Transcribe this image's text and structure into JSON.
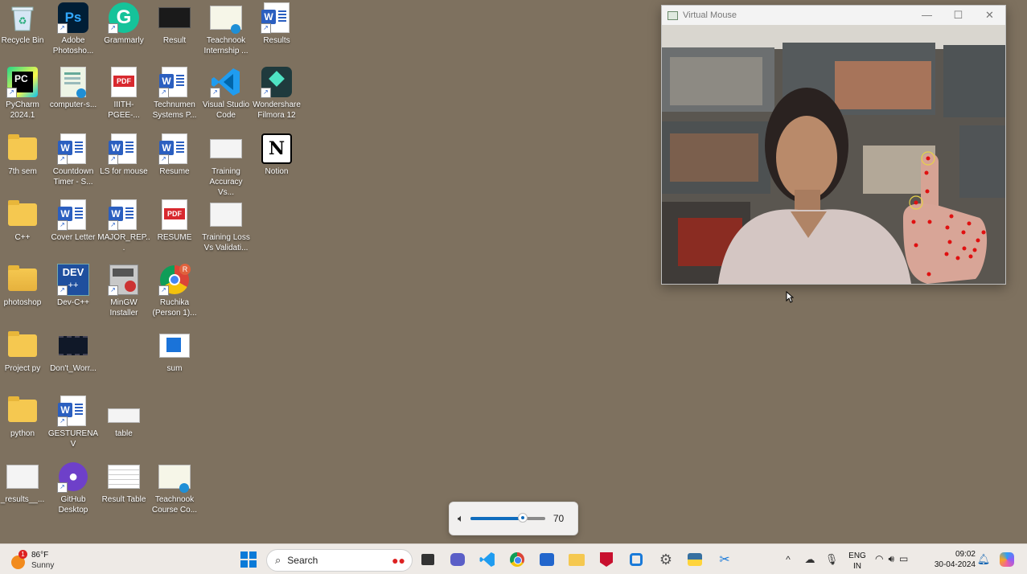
{
  "desktop": {
    "icons": [
      {
        "label": "Recycle Bin",
        "icon": "recycle-bin-icon"
      },
      {
        "label": "Adobe Photosho...",
        "icon": "photoshop-icon"
      },
      {
        "label": "Grammarly",
        "icon": "grammarly-icon"
      },
      {
        "label": "Result",
        "icon": "image-thumbnail-icon"
      },
      {
        "label": "Teachnook Internship ...",
        "icon": "certificate-edge-icon"
      },
      {
        "label": "Results",
        "icon": "word-doc-icon"
      },
      {
        "label": "PyCharm 2024.1",
        "icon": "pycharm-icon"
      },
      {
        "label": "computer-s...",
        "icon": "document-edge-icon"
      },
      {
        "label": "IIITH-PGEE-...",
        "icon": "pdf-icon"
      },
      {
        "label": "Technumen Systems P...",
        "icon": "word-doc-icon"
      },
      {
        "label": "Visual Studio Code",
        "icon": "vscode-icon"
      },
      {
        "label": "Wondershare Filmora 12",
        "icon": "filmora-icon"
      },
      {
        "label": "7th sem",
        "icon": "folder-icon"
      },
      {
        "label": "Countdown Timer - S...",
        "icon": "word-doc-icon"
      },
      {
        "label": "LS for mouse",
        "icon": "word-doc-icon"
      },
      {
        "label": "Resume",
        "icon": "word-doc-icon"
      },
      {
        "label": "Training Accuracy Vs...",
        "icon": "image-thumbnail-icon"
      },
      {
        "label": "Notion",
        "icon": "notion-icon"
      },
      {
        "label": "C++",
        "icon": "folder-icon"
      },
      {
        "label": "Cover Letter",
        "icon": "word-doc-icon"
      },
      {
        "label": "MAJOR_REP...",
        "icon": "word-doc-icon"
      },
      {
        "label": "RESUME",
        "icon": "pdf-icon"
      },
      {
        "label": "Training Loss Vs Validati...",
        "icon": "image-thumbnail-icon"
      },
      {
        "label": "photoshop",
        "icon": "folder-icon"
      },
      {
        "label": "Dev-C++",
        "icon": "devcpp-icon"
      },
      {
        "label": "MinGW Installer",
        "icon": "mingw-icon"
      },
      {
        "label": "Ruchika (Person 1)...",
        "icon": "chrome-profile-icon"
      },
      {
        "label": "Project py",
        "icon": "folder-icon"
      },
      {
        "label": "Don't_Worr...",
        "icon": "video-thumbnail-icon"
      },
      {
        "label": "sum",
        "icon": "app-window-icon"
      },
      {
        "label": "python",
        "icon": "folder-icon"
      },
      {
        "label": "GESTURENAV",
        "icon": "word-doc-icon"
      },
      {
        "label": "table",
        "icon": "image-thumbnail-icon"
      },
      {
        "label": "_results__...",
        "icon": "image-thumbnail-icon"
      },
      {
        "label": "GitHub Desktop",
        "icon": "github-icon"
      },
      {
        "label": "Result Table",
        "icon": "image-thumbnail-icon"
      },
      {
        "label": "Teachnook Course Co...",
        "icon": "certificate-edge-icon"
      }
    ]
  },
  "window": {
    "title": "Virtual Mouse",
    "controls": {
      "minimize": "—",
      "maximize": "☐",
      "close": "✕"
    }
  },
  "volume": {
    "value": "70",
    "level_percent": 70
  },
  "taskbar": {
    "weather": {
      "temp": "86°F",
      "condition": "Sunny",
      "badge": "1"
    },
    "search_placeholder": "Search",
    "apps": [
      "start-icon",
      "search",
      "file-explorer-task-icon",
      "teams-chat-icon",
      "vscode-icon",
      "chrome-icon",
      "store-icon",
      "folder-icon",
      "mcafee-icon",
      "cortana-icon",
      "settings-icon",
      "python-icon",
      "snipping-tool-icon"
    ],
    "tray": {
      "language": "ENG",
      "region": "IN",
      "time": "09:02",
      "date": "30-04-2024"
    }
  },
  "colors": {
    "desktop": "#7e715f",
    "accent": "#0f6cbd"
  }
}
